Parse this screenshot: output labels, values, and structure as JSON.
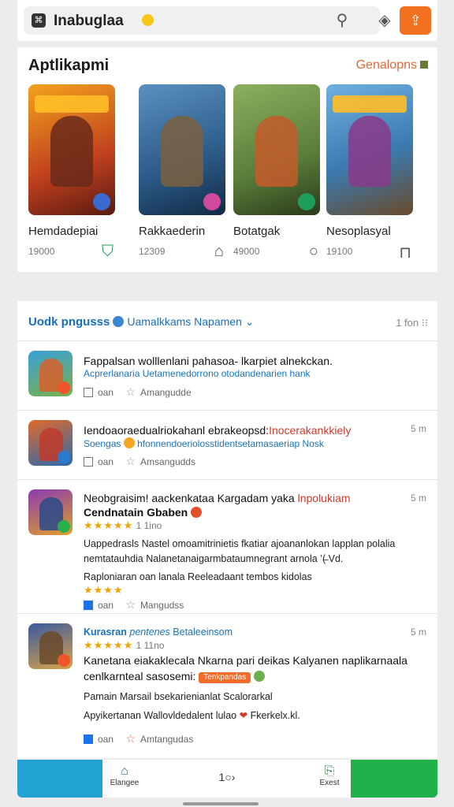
{
  "header": {
    "title": "Inabuglaa",
    "icons": [
      "app-logo-icon",
      "filter-icon",
      "shield-icon",
      "share-icon"
    ]
  },
  "featured": {
    "title": "Aptlikapmi",
    "link": "Genalopns",
    "games": [
      {
        "name": "Hemdadepiai",
        "meta": "19000",
        "icon": "shield-icon",
        "art": "#c0401e",
        "accent": "#f3a21d"
      },
      {
        "name": "Rakkaederin",
        "meta": "12309",
        "icon": "bookmark-icon",
        "art": "#2b5a87",
        "accent": "#d0b070"
      },
      {
        "name": "Botatgak",
        "meta": "49000",
        "icon": "circle-icon",
        "art": "#5a7d3a",
        "accent": "#c45a2a"
      },
      {
        "name": "Nesoplasyal",
        "meta": "19100",
        "icon": "bookmark-icon",
        "art": "#3a7ab0",
        "accent": "#e08a2a"
      }
    ]
  },
  "list": {
    "heading_bold": "Uodk pngusss",
    "heading_rest": "Uamalkkams Napamen",
    "heading_right": "1 fon",
    "items": [
      {
        "title": "Fappalsan wolllenlani pahasoa- lkarpiet alnekckan.",
        "sub": "Acprerlanaria Uetamenedorrono otodandenarien hank",
        "action1": "oan",
        "action2": "Amangudde",
        "time": "",
        "checked": false,
        "colors": [
          "#3aa0d8",
          "#d8602a"
        ]
      },
      {
        "title": "Iendoaoraedualriokahanl ebrakeopsd:",
        "title_hl": "Inocerakankkiely",
        "sub": "Soengas",
        "sub_rest": "hfonnendoeriolosstidentsetamasaeriap Nosk",
        "action1": "oan",
        "action2": "Amsangudds",
        "time": "5 m",
        "checked": false,
        "colors": [
          "#e06a2a",
          "#2a6ab0"
        ]
      },
      {
        "title": "Neobgraisim! aackenkataa Kargadam yaka",
        "title_hl": "lnpolukiam",
        "title2": "Cendnatain Gbaben",
        "rating_text": "1 1ino",
        "body1": "Uappedrasls Nastel omoamitrinietis fkatiar ajoananlokan lapplan polalia",
        "body2": "nemtatauhdia Nalanetanaigarmbataumnegrant arnola ’(̶ Vd.",
        "body3": "Raploniaran oan lanala Reeleadaant tembos kidolas",
        "action1": "oan",
        "action2": "Mangudss",
        "time": "5 m",
        "checked": true,
        "colors": [
          "#8a3ab0",
          "#e0a02a"
        ]
      },
      {
        "sub_lead": "Kurasran",
        "sub_mid": "pentenes",
        "sub_tail": "Betaleeinsom",
        "rating_text": "1 11no",
        "title": "Kanetana eiakaklecala Nkarna pari deikas Kalyanen naplikarnaala",
        "title2": "cenlkarnteal sasosemi:",
        "title2_badge": "Tenkpandas",
        "body1": "Pamain Marsail bsekarienianlat Scalorarkal",
        "body2": "Apyikertanan Wallovldedalent lulao",
        "body2_tail": "Fkerkelx.kl.",
        "action1": "oan",
        "action2": "Amtangudas",
        "time": "5 m",
        "checked": true,
        "colors": [
          "#3a5aa0",
          "#d8a24a"
        ]
      }
    ]
  },
  "bottom_nav": {
    "left_label": "Elangee",
    "mid_label": "1○›",
    "right_label": "Exest"
  }
}
